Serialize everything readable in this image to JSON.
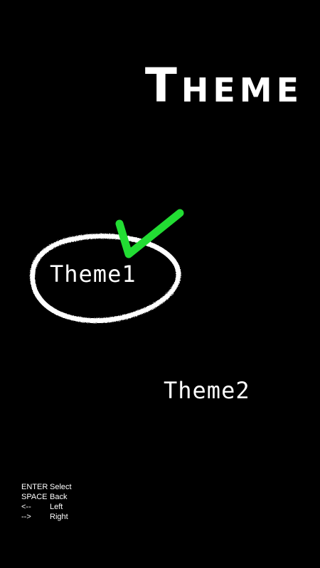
{
  "title": "Theme",
  "themes": [
    {
      "label": "Theme1",
      "selected": true
    },
    {
      "label": "Theme2",
      "selected": false
    }
  ],
  "controls": [
    {
      "key": "ENTER",
      "action": "Select"
    },
    {
      "key": "SPACE",
      "action": "Back"
    },
    {
      "key": "<--",
      "action": "Left"
    },
    {
      "key": "-->",
      "action": "Right"
    }
  ],
  "colors": {
    "background": "#000000",
    "text": "#ffffff",
    "check": "#22dd33",
    "circle": "#ffffff"
  },
  "icons": {
    "selection_circle": "hand-drawn-circle",
    "selected_mark": "checkmark-icon"
  }
}
